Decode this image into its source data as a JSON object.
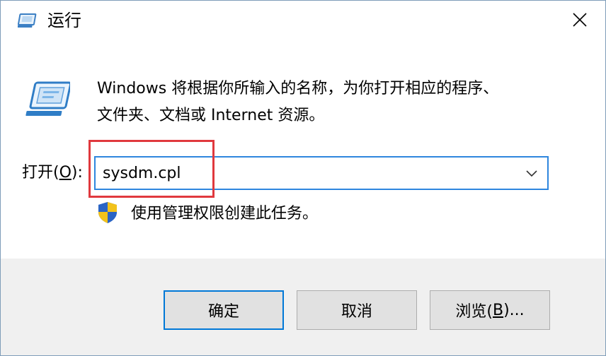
{
  "window": {
    "title": "运行",
    "close_label": "×"
  },
  "content": {
    "description_line1": "Windows 将根据你所输入的名称，为你打开相应的程序、",
    "description_line2": "文件夹、文档或 Internet 资源。",
    "open_label_prefix": "打开(",
    "open_label_accel": "O",
    "open_label_suffix": "):",
    "open_value": "sysdm.cpl",
    "admin_note": "使用管理权限创建此任务。"
  },
  "buttons": {
    "ok_label": "确定",
    "cancel_label": "取消",
    "browse_prefix": "浏览(",
    "browse_accel": "B",
    "browse_suffix": ")..."
  },
  "colors": {
    "highlight_box": "#e0393e",
    "focus_border": "#2e86de",
    "button_bar": "#f0f0f0"
  },
  "icons": {
    "title": "run-dialog-icon",
    "large": "run-program-icon",
    "shield": "uac-shield-icon",
    "close": "close-icon",
    "dropdown": "chevron-down-icon"
  }
}
